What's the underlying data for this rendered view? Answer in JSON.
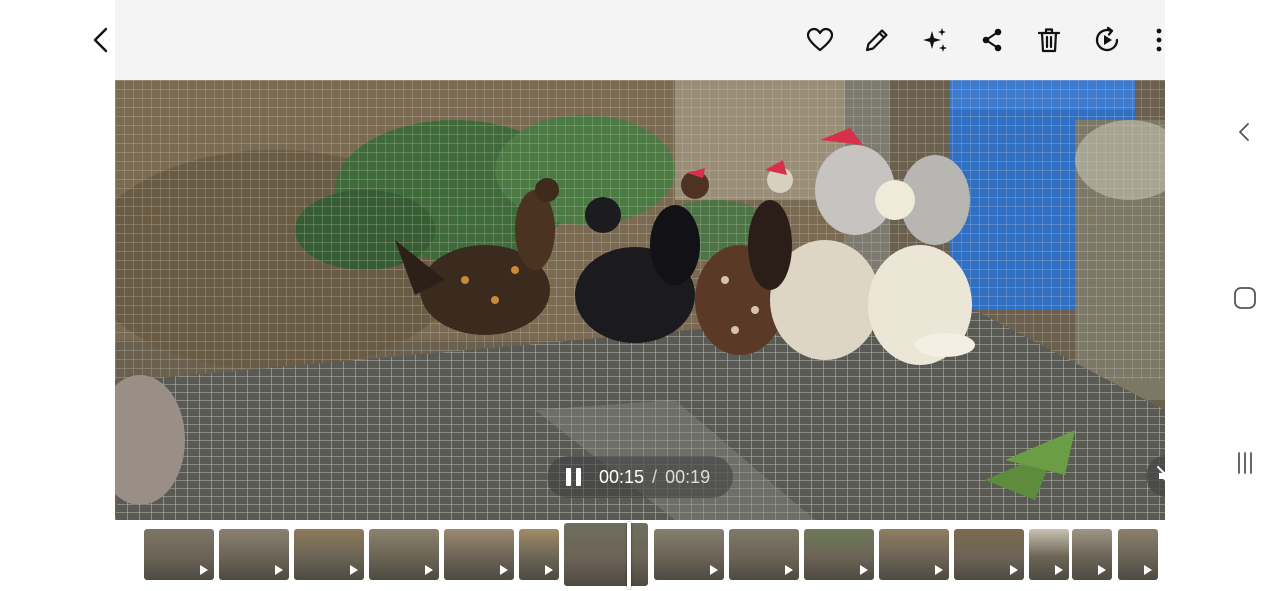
{
  "toolbar": {
    "icons": [
      "back-icon",
      "heart-icon",
      "pencil-icon",
      "sparkle-icon",
      "share-icon",
      "trash-icon",
      "remaster-icon",
      "more-icon"
    ]
  },
  "player": {
    "current_time": "00:15",
    "separator": "/",
    "duration": "00:19",
    "state": "playing",
    "muted": true
  },
  "thumbnails": {
    "count": 15,
    "selected_index": 6,
    "colors": [
      "#7d7565",
      "#8a8170",
      "#8d7a5a",
      "#8b836e",
      "#9b8a72",
      "#a08c68",
      "#6f6f5e",
      "#858070",
      "#7f7a68",
      "#6e7a58",
      "#8f7e62",
      "#7c6a50",
      "#c8c0b0",
      "#9d9585",
      "#8a7f6a"
    ]
  },
  "navigation": {
    "buttons": [
      "back-nav-icon",
      "home-nav-icon",
      "recents-nav-icon"
    ]
  },
  "colors": {
    "accent_icon": "#111111",
    "rooster_comb": "#d8304a",
    "barrel_blue": "#2f6fc4"
  }
}
